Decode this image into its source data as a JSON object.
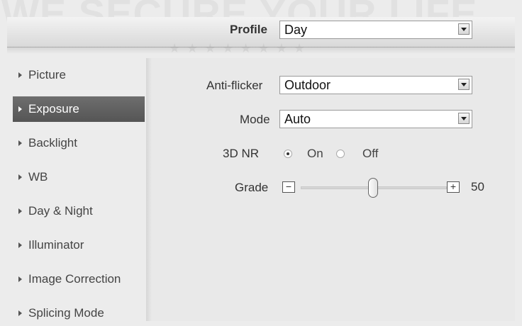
{
  "watermark": {
    "text": "WE SECURE YOUR LIFE",
    "stars": "★★★★★★★★"
  },
  "profile": {
    "label": "Profile",
    "value": "Day"
  },
  "sidebar": {
    "items": [
      {
        "label": "Picture",
        "active": false
      },
      {
        "label": "Exposure",
        "active": true
      },
      {
        "label": "Backlight",
        "active": false
      },
      {
        "label": "WB",
        "active": false
      },
      {
        "label": "Day & Night",
        "active": false
      },
      {
        "label": "Illuminator",
        "active": false
      },
      {
        "label": "Image Correction",
        "active": false
      },
      {
        "label": "Splicing Mode",
        "active": false
      }
    ]
  },
  "exposure": {
    "anti_flicker": {
      "label": "Anti-flicker",
      "value": "Outdoor"
    },
    "mode": {
      "label": "Mode",
      "value": "Auto"
    },
    "nr3d": {
      "label": "3D NR",
      "on_label": "On",
      "off_label": "Off",
      "selected": "On"
    },
    "grade": {
      "label": "Grade",
      "minus": "−",
      "plus": "+",
      "value": "50",
      "fraction": 0.5
    }
  },
  "colors": {
    "active_item": "#5f5f5f",
    "panel": "#e9e9e9"
  }
}
